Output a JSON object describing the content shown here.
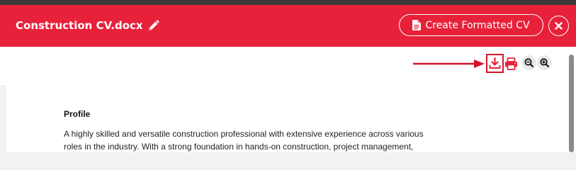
{
  "header": {
    "title": "Construction CV.docx",
    "create_button_label": "Create Formatted CV",
    "background_color": "#e8213a"
  },
  "toolbar": {
    "icons": [
      "download-icon",
      "print-icon",
      "zoom-out-icon",
      "zoom-in-icon"
    ],
    "highlight_color": "#d8102a"
  },
  "document": {
    "heading": "Profile",
    "paragraph_lines": [
      "A highly skilled and versatile construction professional with extensive experience across various",
      "roles in the industry. With a strong foundation in hands-on construction, project management,"
    ]
  }
}
